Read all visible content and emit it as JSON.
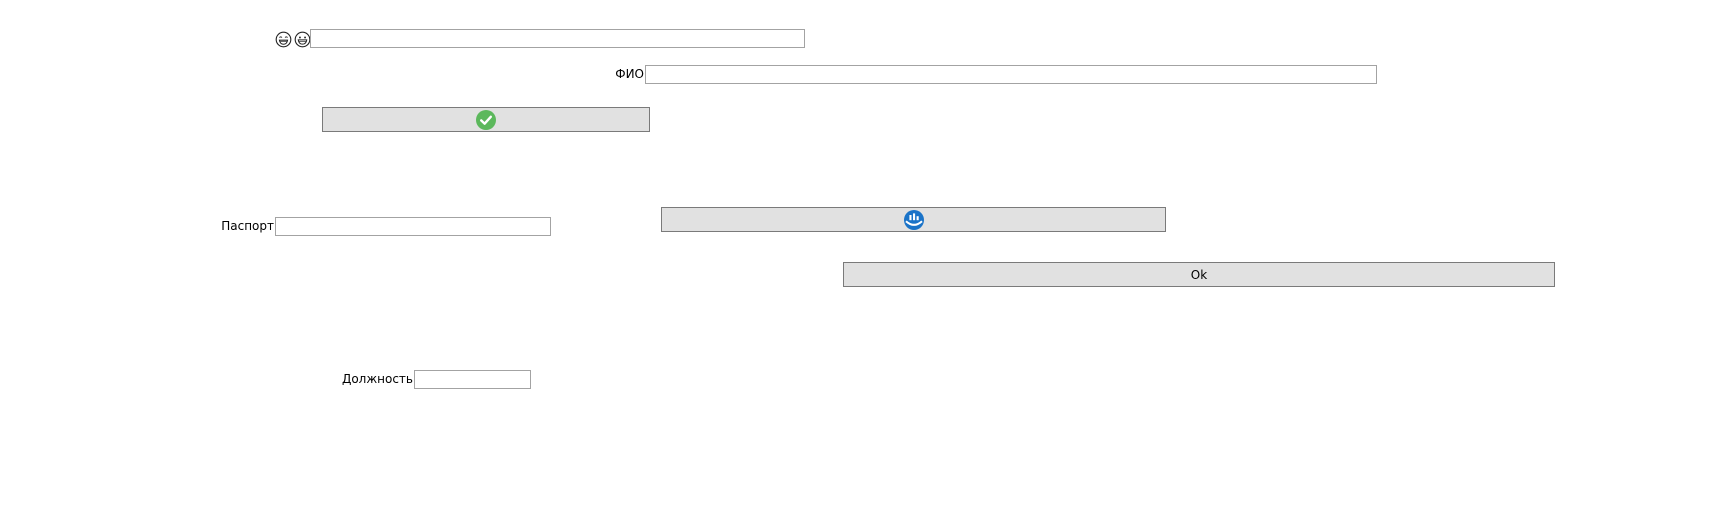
{
  "form": {
    "top_input": {
      "value": "",
      "icons": [
        "laughing-face-icon",
        "grinning-face-icon"
      ]
    },
    "fio": {
      "label": "ФИО",
      "value": ""
    },
    "check_button": {
      "icon": "green-checkmark-icon",
      "accent_color": "#5cb85c"
    },
    "passport": {
      "label": "Паспорт",
      "value": ""
    },
    "globe_button": {
      "icon": "blue-globe-icon",
      "accent_color": "#1a73c8"
    },
    "ok_button": {
      "label": "Ok"
    },
    "position": {
      "label": "Должность",
      "value": ""
    }
  }
}
